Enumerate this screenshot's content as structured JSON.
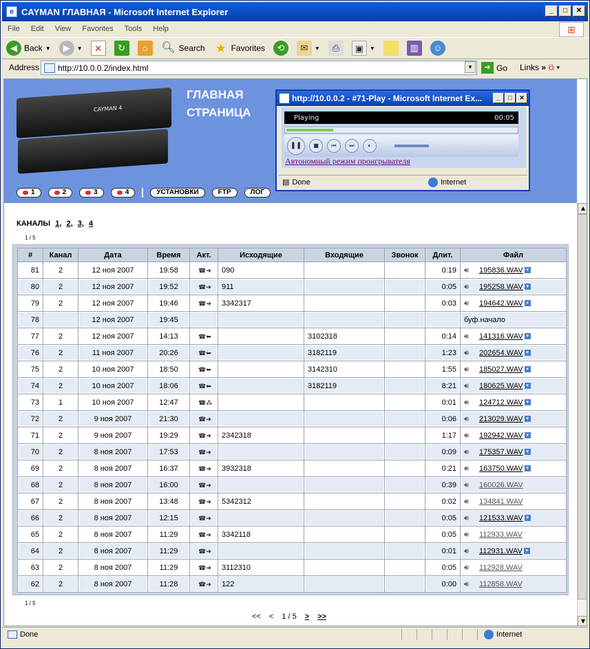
{
  "window": {
    "title": "CAYMAN ГЛАВНАЯ - Microsoft Internet Explorer"
  },
  "menu": [
    "File",
    "Edit",
    "View",
    "Favorites",
    "Tools",
    "Help"
  ],
  "toolbar": {
    "back": "Back",
    "search": "Search",
    "favorites": "Favorites"
  },
  "address": {
    "label": "Address",
    "url": "http://10.0.0.2/index.html",
    "go": "Go",
    "links": "Links"
  },
  "banner": {
    "title_line1": "ГЛАВНАЯ",
    "title_line2": "СТРАНИЦА",
    "device_label": "CAYMAN 4",
    "nav": [
      "1",
      "2",
      "3",
      "4"
    ],
    "nav_settings": "УСТАНОВКИ",
    "nav_ftp": "FTP",
    "nav_log": "ЛОГ"
  },
  "popup": {
    "title": "http://10.0.0.2 - #71-Play - Microsoft Internet Ex...",
    "state": "Playing",
    "time": "00:05",
    "link": "Автономный режим проигрывателя",
    "status": "Done",
    "zone": "Internet"
  },
  "channels": {
    "label": "КАНАЛЫ",
    "items": [
      "1,",
      "2,",
      "3,",
      "4"
    ]
  },
  "page_small": "1 / 5",
  "table": {
    "headers": [
      "#",
      "Канал",
      "Дата",
      "Время",
      "Акт.",
      "Исходящие",
      "Входящие",
      "Звонок",
      "Длит.",
      "Файл"
    ],
    "rows": [
      {
        "n": "81",
        "ch": "2",
        "date": "12 ноя 2007",
        "time": "19:58",
        "act": "out",
        "out": "090",
        "in": "",
        "call": "",
        "dur": "0:19",
        "file": "195836.WAV",
        "v": true,
        "gray": false
      },
      {
        "n": "80",
        "ch": "2",
        "date": "12 ноя 2007",
        "time": "19:52",
        "act": "out",
        "out": "911",
        "in": "",
        "call": "",
        "dur": "0:05",
        "file": "195258.WAV",
        "v": true,
        "gray": false
      },
      {
        "n": "79",
        "ch": "2",
        "date": "12 ноя 2007",
        "time": "19:46",
        "act": "out",
        "out": "3342317",
        "in": "",
        "call": "",
        "dur": "0:03",
        "file": "194642.WAV",
        "v": true,
        "gray": false
      },
      {
        "n": "78",
        "ch": "",
        "date": "12 ноя 2007",
        "time": "19:45",
        "act": "",
        "out": "",
        "in": "",
        "call": "",
        "dur": "",
        "file": "буф.начало",
        "v": false,
        "gray": false,
        "text": true
      },
      {
        "n": "77",
        "ch": "2",
        "date": "12 ноя 2007",
        "time": "14:13",
        "act": "in",
        "out": "",
        "in": "3102318",
        "call": "",
        "dur": "0:14",
        "file": "141316.WAV",
        "v": true,
        "gray": false
      },
      {
        "n": "76",
        "ch": "2",
        "date": "11 ноя 2007",
        "time": "20:26",
        "act": "in",
        "out": "",
        "in": "3182119",
        "call": "",
        "dur": "1:23",
        "file": "202654.WAV",
        "v": true,
        "gray": false
      },
      {
        "n": "75",
        "ch": "2",
        "date": "10 ноя 2007",
        "time": "18:50",
        "act": "in",
        "out": "",
        "in": "3142310",
        "call": "",
        "dur": "1:55",
        "file": "185027.WAV",
        "v": true,
        "gray": false
      },
      {
        "n": "74",
        "ch": "2",
        "date": "10 ноя 2007",
        "time": "18:06",
        "act": "in",
        "out": "",
        "in": "3182119",
        "call": "",
        "dur": "8:21",
        "file": "180625.WAV",
        "v": true,
        "gray": false
      },
      {
        "n": "73",
        "ch": "1",
        "date": "10 ноя 2007",
        "time": "12:47",
        "act": "ring",
        "out": "",
        "in": "",
        "call": "",
        "dur": "0:01",
        "file": "124712.WAV",
        "v": true,
        "gray": false
      },
      {
        "n": "72",
        "ch": "2",
        "date": "9 ноя 2007",
        "time": "21:30",
        "act": "out",
        "out": "",
        "in": "",
        "call": "",
        "dur": "0:06",
        "file": "213029.WAV",
        "v": true,
        "gray": false
      },
      {
        "n": "71",
        "ch": "2",
        "date": "9 ноя 2007",
        "time": "19:29",
        "act": "out",
        "out": "2342318",
        "in": "",
        "call": "",
        "dur": "1:17",
        "file": "192942.WAV",
        "v": true,
        "gray": false
      },
      {
        "n": "70",
        "ch": "2",
        "date": "8 ноя 2007",
        "time": "17:53",
        "act": "out",
        "out": "",
        "in": "",
        "call": "",
        "dur": "0:09",
        "file": "175357.WAV",
        "v": true,
        "gray": false
      },
      {
        "n": "69",
        "ch": "2",
        "date": "8 ноя 2007",
        "time": "16:37",
        "act": "out",
        "out": "3932318",
        "in": "",
        "call": "",
        "dur": "0:21",
        "file": "163750.WAV",
        "v": true,
        "gray": false
      },
      {
        "n": "68",
        "ch": "2",
        "date": "8 ноя 2007",
        "time": "16:00",
        "act": "out",
        "out": "",
        "in": "",
        "call": "",
        "dur": "0:39",
        "file": "160026.WAV",
        "v": false,
        "gray": true
      },
      {
        "n": "67",
        "ch": "2",
        "date": "8 ноя 2007",
        "time": "13:48",
        "act": "out",
        "out": "5342312",
        "in": "",
        "call": "",
        "dur": "0:02",
        "file": "134841.WAV",
        "v": false,
        "gray": true
      },
      {
        "n": "66",
        "ch": "2",
        "date": "8 ноя 2007",
        "time": "12:15",
        "act": "out",
        "out": "",
        "in": "",
        "call": "",
        "dur": "0:05",
        "file": "121533.WAV",
        "v": true,
        "gray": false
      },
      {
        "n": "65",
        "ch": "2",
        "date": "8 ноя 2007",
        "time": "11:29",
        "act": "out",
        "out": "3342118",
        "in": "",
        "call": "",
        "dur": "0:05",
        "file": "112933.WAV",
        "v": false,
        "gray": true
      },
      {
        "n": "64",
        "ch": "2",
        "date": "8 ноя 2007",
        "time": "11:29",
        "act": "out",
        "out": "",
        "in": "",
        "call": "",
        "dur": "0:01",
        "file": "112931.WAV",
        "v": true,
        "gray": false
      },
      {
        "n": "63",
        "ch": "2",
        "date": "8 ноя 2007",
        "time": "11:29",
        "act": "out",
        "out": "3112310",
        "in": "",
        "call": "",
        "dur": "0:05",
        "file": "112928.WAV",
        "v": false,
        "gray": true
      },
      {
        "n": "62",
        "ch": "2",
        "date": "8 ноя 2007",
        "time": "11:28",
        "act": "out",
        "out": "122",
        "in": "",
        "call": "",
        "dur": "0:00",
        "file": "112858.WAV",
        "v": false,
        "gray": true
      }
    ]
  },
  "pager": {
    "first": "<<",
    "prev": "<",
    "current": "1 / 5",
    "next": ">",
    "last": ">>"
  },
  "status": {
    "text": "Done",
    "zone": "Internet"
  }
}
